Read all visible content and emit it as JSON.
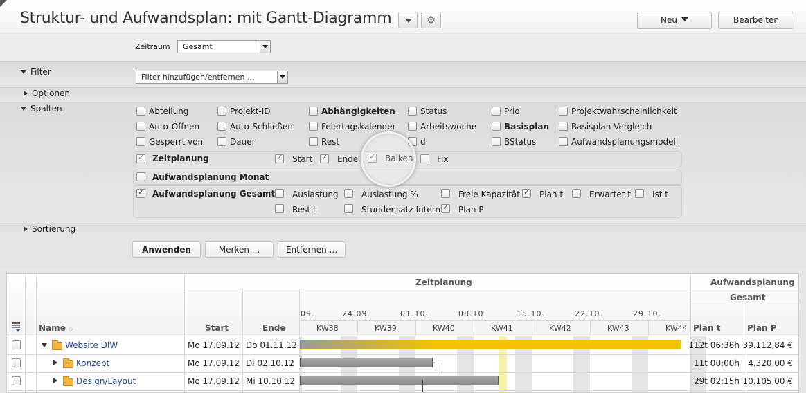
{
  "header": {
    "title": "Struktur- und Aufwandsplan: mit Gantt-Diagramm",
    "new_button": "Neu",
    "edit_button": "Bearbeiten"
  },
  "zeitraum": {
    "label": "Zeitraum",
    "value": "Gesamt"
  },
  "filter": {
    "label": "Filter",
    "select_value": "Filter hinzufügen/entfernen ..."
  },
  "optionen": {
    "label": "Optionen"
  },
  "spalten": {
    "label": "Spalten",
    "rows": [
      [
        {
          "label": "Abteilung",
          "checked": false,
          "bold": false
        },
        {
          "label": "Projekt-ID",
          "checked": false,
          "bold": false
        },
        {
          "label": "Abhängigkeiten",
          "checked": false,
          "bold": true
        },
        {
          "label": "Status",
          "checked": false,
          "bold": false
        },
        {
          "label": "Prio",
          "checked": false,
          "bold": false
        },
        {
          "label": "Projektwahrscheinlichkeit",
          "checked": false,
          "bold": false
        }
      ],
      [
        {
          "label": "Auto-Öffnen",
          "checked": false,
          "bold": false
        },
        {
          "label": "Auto-Schließen",
          "checked": false,
          "bold": false
        },
        {
          "label": "Feiertagskalender",
          "checked": false,
          "bold": false
        },
        {
          "label": "Arbeitswoche",
          "checked": false,
          "bold": false
        },
        {
          "label": "Basisplan",
          "checked": false,
          "bold": true
        },
        {
          "label": "Basisplan Vergleich",
          "checked": false,
          "bold": false
        }
      ],
      [
        {
          "label": "Gesperrt von",
          "checked": false,
          "bold": false
        },
        {
          "label": "Dauer",
          "checked": false,
          "bold": false
        },
        {
          "label": "Rest",
          "checked": false,
          "bold": false
        },
        {
          "label": "d",
          "checked": false,
          "bold": false
        },
        {
          "label": "BStatus",
          "checked": false,
          "bold": false
        },
        {
          "label": "Aufwandsplanungsmodell",
          "checked": false,
          "bold": false
        }
      ]
    ],
    "zeitplanung": {
      "label": "Zeitplanung",
      "checked": true,
      "items": [
        {
          "label": "Start",
          "checked": true
        },
        {
          "label": "Ende",
          "checked": true
        },
        {
          "label": "Balken",
          "checked": true
        },
        {
          "label": "Fix",
          "checked": false
        }
      ]
    },
    "monat": {
      "label": "Aufwandsplanung Monat",
      "checked": false
    },
    "gesamt": {
      "label": "Aufwandsplanung Gesamt",
      "checked": true,
      "row1": [
        {
          "label": "Auslastung",
          "checked": false
        },
        {
          "label": "Auslastung %",
          "checked": false
        },
        {
          "label": "Freie Kapazität",
          "checked": false
        },
        {
          "label": "Plan t",
          "checked": true
        },
        {
          "label": "Erwartet t",
          "checked": false
        },
        {
          "label": "Ist t",
          "checked": false
        }
      ],
      "row2": [
        {
          "label": "Rest t",
          "checked": false
        },
        {
          "label": "Stundensatz Intern",
          "checked": false
        },
        {
          "label": "Plan P",
          "checked": true
        }
      ]
    }
  },
  "sortierung": {
    "label": "Sortierung"
  },
  "actions": {
    "apply": "Anwenden",
    "remember": "Merken ...",
    "remove": "Entfernen ..."
  },
  "table": {
    "group_zeitplanung": "Zeitplanung",
    "group_aufwand": "Aufwandsplanung",
    "group_gesamt": "Gesamt",
    "col_name": "Name",
    "col_start": "Start",
    "col_end": "Ende",
    "col_plan_t": "Plan t",
    "col_plan_p": "Plan P",
    "dates": [
      "09.",
      "24.09.",
      "01.10.",
      "08.10.",
      "15.10.",
      "22.10.",
      "29.10."
    ],
    "weeks": [
      "KW38",
      "KW39",
      "KW40",
      "KW41",
      "KW42",
      "KW43",
      "KW44"
    ],
    "rows": [
      {
        "name": "Website DIW",
        "start": "Mo 17.09.12",
        "end": "Do 01.11.12",
        "plan_t": "112t 06:38h",
        "plan_p": "39.112,84 €",
        "expanded": true,
        "level": 0
      },
      {
        "name": "Konzept",
        "start": "Mo 17.09.12",
        "end": "Di 02.10.12",
        "plan_t": "11t 00:00h",
        "plan_p": "4.320,00 €",
        "expanded": false,
        "level": 1
      },
      {
        "name": "Design/Layout",
        "start": "Mo 17.09.12",
        "end": "Mi 10.10.12",
        "plan_t": "29t 02:15h",
        "plan_p": "10.105,00 €",
        "expanded": false,
        "level": 1
      }
    ]
  },
  "colors": {
    "summary_bar": "#f2c200",
    "task_bar": "#8a8a8a",
    "today": "#f4f2a8",
    "link": "#244a8c"
  }
}
